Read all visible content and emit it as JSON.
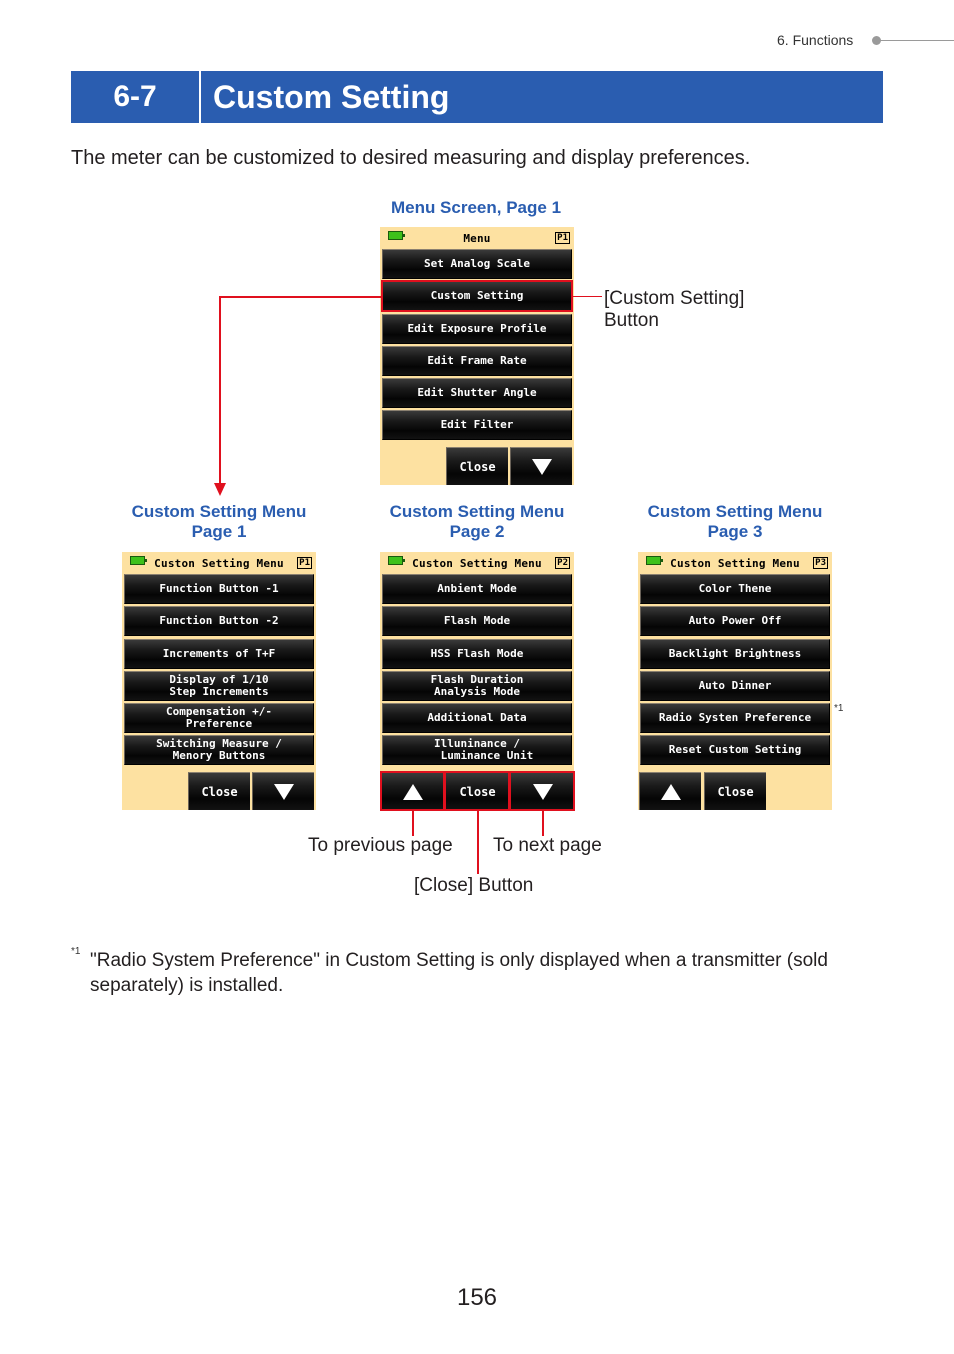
{
  "header": {
    "breadcrumb": "6.  Functions"
  },
  "section": {
    "number": "6-7",
    "title": "Custom Setting"
  },
  "intro": "The meter can be customized to desired measuring and display preferences.",
  "menu_screen": {
    "caption": "Menu Screen, Page 1",
    "screen_title": "Menu",
    "page_badge": "P1",
    "items": [
      "Set Analog Scale",
      "Custom Setting",
      "Edit Exposure Profile",
      "Edit Frame Rate",
      "Edit Shutter Angle",
      "Edit Filter"
    ],
    "close_label": "Close",
    "callout": "[Custom Setting]\nButton"
  },
  "custom_pages": [
    {
      "caption_line1": "Custom Setting Menu",
      "caption_line2": "Page 1",
      "screen_title": "Custon Setting Menu",
      "page_badge": "P1",
      "items": [
        "Function Button -1",
        "Function Button -2",
        "Increments of T+F",
        "Display of 1/10\nStep Increments",
        "Compensation +/-\nPreference",
        "Switching Measure /\nMenory Buttons"
      ],
      "close_label": "Close"
    },
    {
      "caption_line1": "Custom Setting Menu",
      "caption_line2": "Page 2",
      "screen_title": "Custon Setting Menu",
      "page_badge": "P2",
      "items": [
        "Anbient Mode",
        "Flash Mode",
        "HSS Flash Mode",
        "Flash Duration\nAnalysis Mode",
        "Additional Data",
        "Illuninance /\n   Luminance Unit"
      ],
      "close_label": "Close"
    },
    {
      "caption_line1": "Custom Setting Menu",
      "caption_line2": "Page 3",
      "screen_title": "Custon Setting Menu",
      "page_badge": "P3",
      "items": [
        "Color Thene",
        "Auto Power Off",
        "Backlight Brightness",
        "Auto Dinner",
        "Radio Systen Preference",
        "Reset Custom Setting"
      ],
      "close_label": "Close",
      "footnote_marker": "*1"
    }
  ],
  "annotations": {
    "prev": "To previous page",
    "next": "To next page",
    "close": "[Close] Button"
  },
  "footnote": {
    "marker": "*1",
    "text": "\"Radio System Preference\" in Custom Setting is only displayed when a transmitter (sold separately) is installed."
  },
  "page_number": "156",
  "colors": {
    "accent_blue": "#2a5db0",
    "callout_red": "#e0101e",
    "screen_bg": "#fde1a1"
  }
}
